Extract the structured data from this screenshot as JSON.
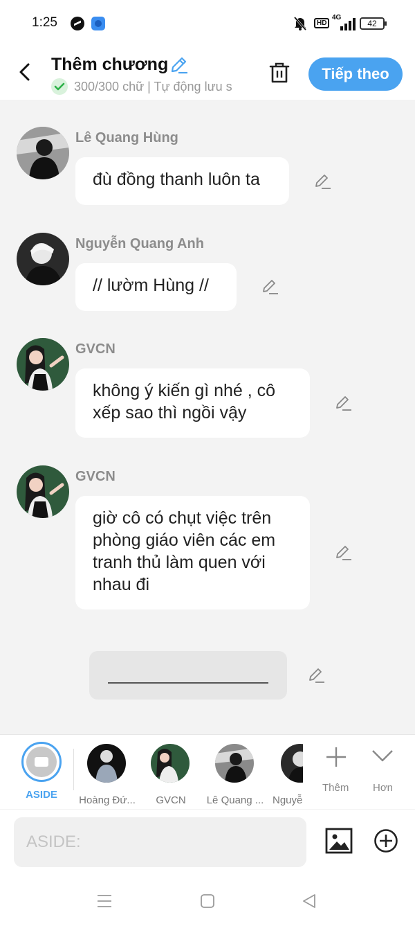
{
  "status_bar": {
    "time": "1:25",
    "network": "4G",
    "hd": "HD",
    "battery": "42"
  },
  "header": {
    "title": "Thêm chương",
    "subtitle": "300/300 chữ | Tự động lưu s",
    "next_label": "Tiếp theo"
  },
  "messages": [
    {
      "sender": "Lê Quang Hùng",
      "text": "đù đồng thanh luôn ta"
    },
    {
      "sender": "Nguyễn Quang Anh",
      "text": "// lườm Hùng //"
    },
    {
      "sender": "GVCN",
      "text": "không ý kiến gì nhé , cô xếp sao thì ngồi vậy"
    },
    {
      "sender": "GVCN",
      "text": "giờ cô có chụt việc trên phòng giáo viên các em tranh thủ làm quen với nhau đi"
    }
  ],
  "character_bar": {
    "aside_label": "ASIDE",
    "characters": [
      "Hoàng Đứ...",
      "GVCN",
      "Lê Quang ...",
      "Nguyễ"
    ],
    "more_label": "Thêm",
    "collapse_label": "Hơn"
  },
  "composer": {
    "placeholder": "ASIDE:"
  },
  "colors": {
    "accent": "#4aa3f0",
    "background": "#f3f3f3",
    "bubble": "#ffffff",
    "muted_text": "#8c8c8c"
  }
}
